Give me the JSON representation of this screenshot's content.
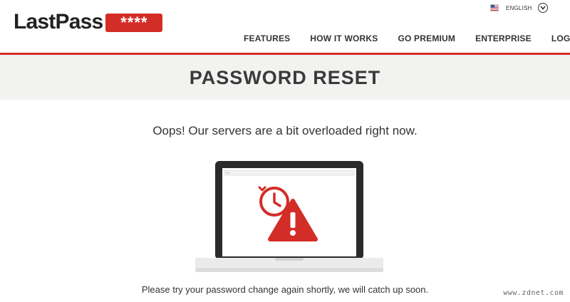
{
  "brand": {
    "logo_text": "LastPass",
    "logo_stars": "****",
    "accent_color": "#d32d27"
  },
  "language": {
    "flag_icon": "us-flag-icon",
    "label": "ENGLISH",
    "dropdown_icon": "chevron-down-icon"
  },
  "nav": {
    "items": [
      {
        "label": "FEATURES"
      },
      {
        "label": "HOW IT WORKS"
      },
      {
        "label": "GO PREMIUM"
      },
      {
        "label": "ENTERPRISE"
      },
      {
        "label": "LOG IN"
      }
    ]
  },
  "page": {
    "title": "PASSWORD RESET",
    "message": "Oops! Our servers are a bit overloaded right now.",
    "illustration_icons": [
      "laptop-icon",
      "clock-icon",
      "warning-icon"
    ],
    "footer_message": "Please try your password change again shortly, we will catch up soon."
  },
  "watermark": "www.zdnet.com"
}
